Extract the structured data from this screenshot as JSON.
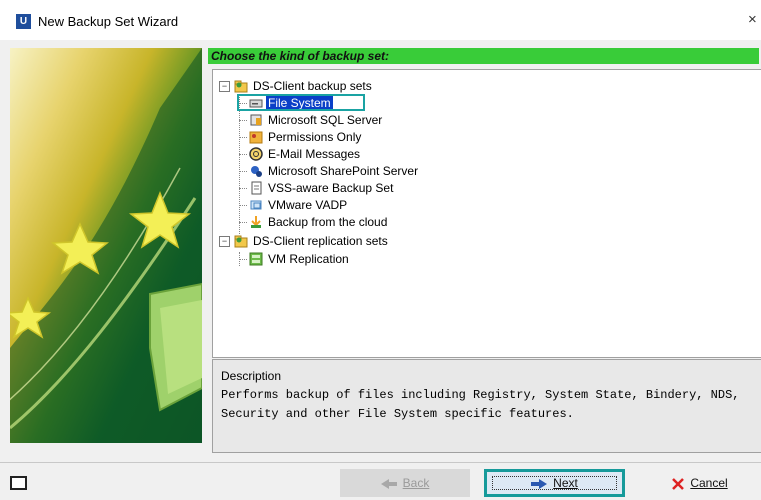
{
  "window": {
    "title": "New Backup Set Wizard",
    "app_icon": "U",
    "close_glyph": "×"
  },
  "header": {
    "text": "Choose the kind of backup set:",
    "color": "#39cc39"
  },
  "tree": [
    {
      "label": "DS-Client backup sets",
      "icon": "folder-group-icon",
      "level": 0,
      "expander": "−"
    },
    {
      "label": "File System",
      "icon": "hard-drive-icon",
      "level": 1,
      "selected": true
    },
    {
      "label": "Microsoft SQL Server",
      "icon": "database-icon",
      "level": 1
    },
    {
      "label": "Permissions Only",
      "icon": "key-icon",
      "level": 1
    },
    {
      "label": "E-Mail Messages",
      "icon": "email-icon",
      "level": 1
    },
    {
      "label": "Microsoft SharePoint Server",
      "icon": "sharepoint-icon",
      "level": 1
    },
    {
      "label": "VSS-aware Backup Set",
      "icon": "document-icon",
      "level": 1
    },
    {
      "label": "VMware VADP",
      "icon": "vmware-icon",
      "level": 1
    },
    {
      "label": "Backup from the cloud",
      "icon": "cloud-download-icon",
      "level": 1
    },
    {
      "label": "DS-Client replication sets",
      "icon": "folder-group-icon",
      "level": 0,
      "expander": "−"
    },
    {
      "label": "VM Replication",
      "icon": "vm-replication-icon",
      "level": 1
    }
  ],
  "description": {
    "label": "Description",
    "text": "Performs backup of files including Registry, System State, Bindery, NDS, Security and other File System specific features."
  },
  "buttons": {
    "back": "Back",
    "next": "Next",
    "cancel": "Cancel"
  }
}
